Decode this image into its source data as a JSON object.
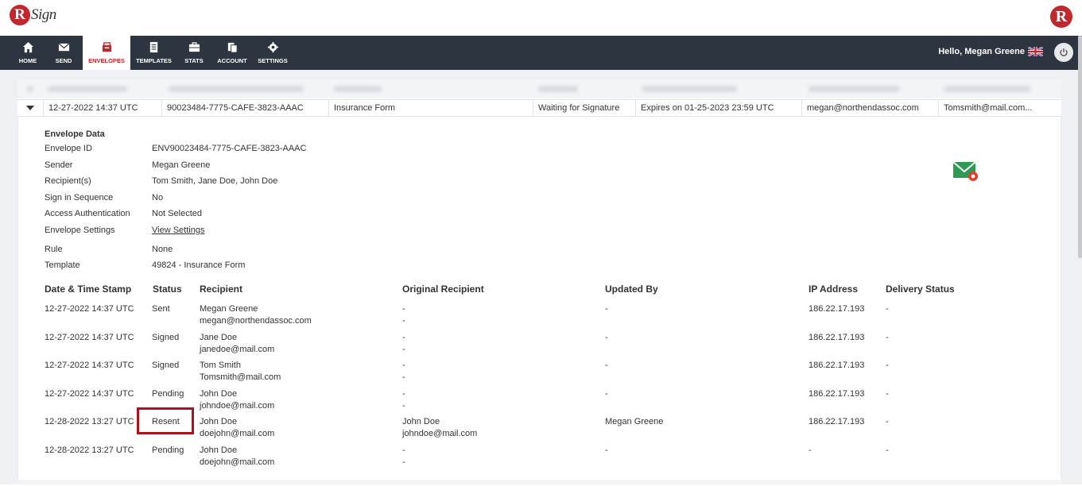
{
  "app": {
    "logo_letter": "R",
    "logo_word": "Sign"
  },
  "nav": {
    "items": [
      {
        "label": "HOME",
        "icon": "home-icon"
      },
      {
        "label": "SEND",
        "icon": "envelope-icon"
      },
      {
        "label": "ENVELOPES",
        "icon": "inbox-icon"
      },
      {
        "label": "TEMPLATES",
        "icon": "document-icon"
      },
      {
        "label": "STATS",
        "icon": "briefcase-icon"
      },
      {
        "label": "ACCOUNT",
        "icon": "files-icon"
      },
      {
        "label": "SETTINGS",
        "icon": "gear-icon"
      }
    ],
    "active": "ENVELOPES",
    "greeting": "Hello, Megan Greene"
  },
  "envelope_row": {
    "date": "12-27-2022 14:37 UTC",
    "id": "90023484-7775-CAFE-3823-AAAC",
    "subject": "Insurance Form",
    "status": "Waiting for Signature",
    "expiry": "Expires on 01-25-2023 23:59 UTC",
    "sender_email": "megan@northendassoc.com",
    "recipient_email": "Tomsmith@mail.com..."
  },
  "envelope_data": {
    "title": "Envelope Data",
    "fields": [
      {
        "label": "Envelope ID",
        "value": "ENV90023484-7775-CAFE-3823-AAAC"
      },
      {
        "label": "Sender",
        "value": "Megan Greene"
      },
      {
        "label": "Recipient(s)",
        "value": "Tom Smith, Jane Doe, John Doe"
      },
      {
        "label": "Sign in Sequence",
        "value": "No"
      },
      {
        "label": "Access Authentication",
        "value": "Not Selected"
      },
      {
        "label": "Envelope Settings",
        "value": "View Settings"
      },
      {
        "label": "Rule",
        "value": "None"
      },
      {
        "label": "Template",
        "value": "49824 - Insurance Form"
      }
    ]
  },
  "history": {
    "headers": [
      "Date & Time Stamp",
      "Status",
      "Recipient",
      "Original Recipient",
      "Updated By",
      "IP Address",
      "Delivery Status"
    ],
    "rows": [
      {
        "date": "12-27-2022 14:37 UTC",
        "status": "Sent",
        "recipient_name": "Megan Greene",
        "recipient_email": "megan@northendassoc.com",
        "orig_name": "-",
        "orig_email": "-",
        "updated_by": "-",
        "ip": "186.22.17.193",
        "delivery": "-"
      },
      {
        "date": "12-27-2022 14:37 UTC",
        "status": "Signed",
        "recipient_name": "Jane Doe",
        "recipient_email": "janedoe@mail.com",
        "orig_name": "-",
        "orig_email": "-",
        "updated_by": "-",
        "ip": "186.22.17.193",
        "delivery": "-"
      },
      {
        "date": "12-27-2022 14:37 UTC",
        "status": "Signed",
        "recipient_name": "Tom Smith",
        "recipient_email": "Tomsmith@mail.com",
        "orig_name": "-",
        "orig_email": "-",
        "updated_by": "-",
        "ip": "186.22.17.193",
        "delivery": "-"
      },
      {
        "date": "12-27-2022 14:37 UTC",
        "status": "Pending",
        "recipient_name": "John Doe",
        "recipient_email": "johndoe@mail.com",
        "orig_name": "-",
        "orig_email": "-",
        "updated_by": "-",
        "ip": "186.22.17.193",
        "delivery": "-"
      },
      {
        "date": "12-28-2022 13:27 UTC",
        "status": "Resent",
        "recipient_name": "John Doe",
        "recipient_email": "doejohn@mail.com",
        "orig_name": "John Doe",
        "orig_email": "johndoe@mail.com",
        "updated_by": "Megan Greene",
        "ip": "186.22.17.193",
        "delivery": "-"
      },
      {
        "date": "12-28-2022 13:27 UTC",
        "status": "Pending",
        "recipient_name": "John Doe",
        "recipient_email": "doejohn@mail.com",
        "orig_name": "-",
        "orig_email": "-",
        "updated_by": "-",
        "ip": "-",
        "delivery": "-"
      }
    ]
  },
  "colors": {
    "brand_red": "#c1272d",
    "nav_bg": "#2d3640",
    "highlight": "#a8141c"
  }
}
